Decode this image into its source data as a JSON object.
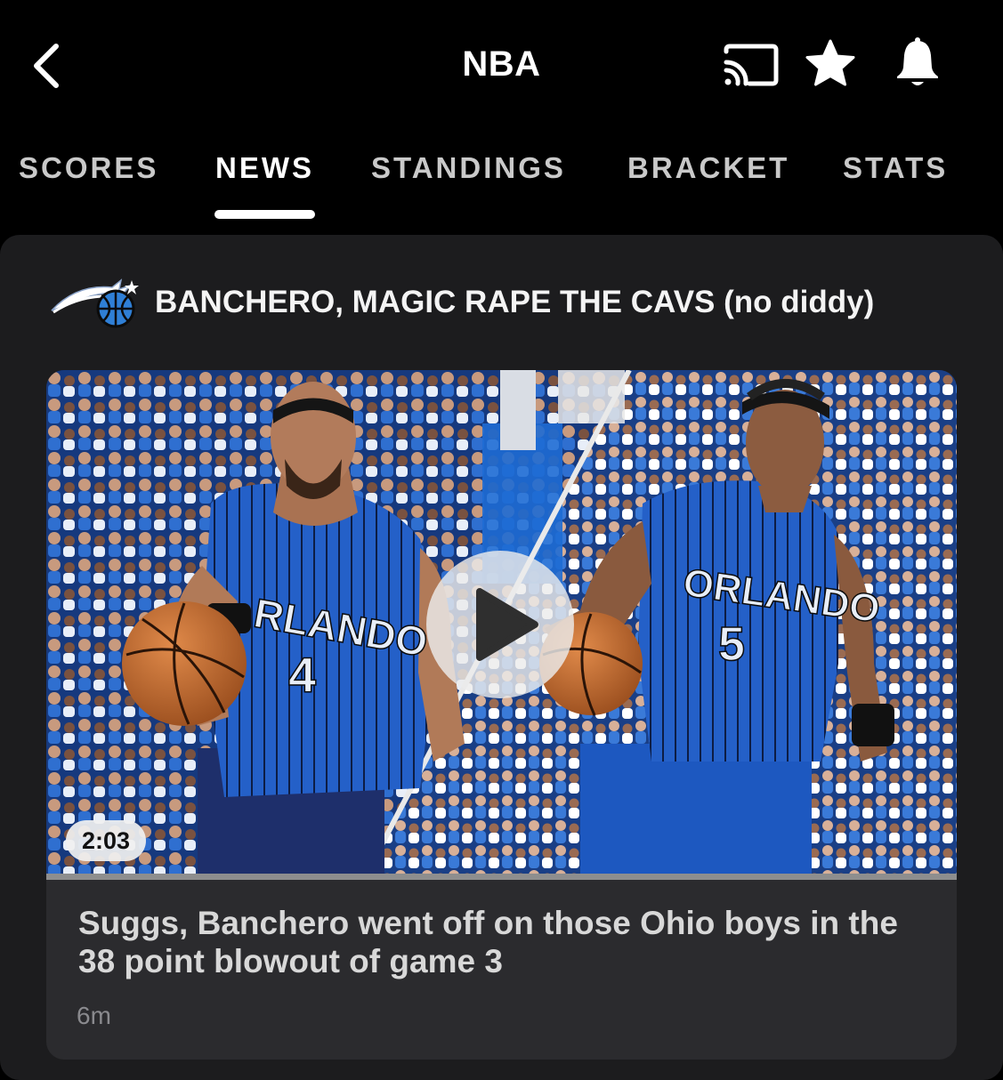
{
  "header": {
    "title": "NBA",
    "icons": [
      "back-chevron-icon",
      "cast-icon",
      "star-icon",
      "bell-icon"
    ]
  },
  "tabs": [
    {
      "label": "SCORES",
      "active": false
    },
    {
      "label": "NEWS",
      "active": true
    },
    {
      "label": "STANDINGS",
      "active": false
    },
    {
      "label": "BRACKET",
      "active": false
    },
    {
      "label": "STATS",
      "active": false
    }
  ],
  "card": {
    "team_icon": "orlando-magic-logo",
    "headline": "BANCHERO, MAGIC RAPE THE CAVS",
    "headline_paren": "(no diddy)",
    "story": {
      "duration": "2:03",
      "title": "Suggs, Banchero went off on those Ohio boys in the 38 point blowout of game 3",
      "time": "6m",
      "left_player": {
        "jersey_text": "ORLANDO",
        "number": "4"
      },
      "right_player": {
        "jersey_text": "ORLANDO",
        "number": "5"
      }
    }
  },
  "colors": {
    "background": "#000000",
    "card": "#1c1c1e",
    "magic_blue": "#1f5fc9",
    "magic_black": "#111111"
  }
}
